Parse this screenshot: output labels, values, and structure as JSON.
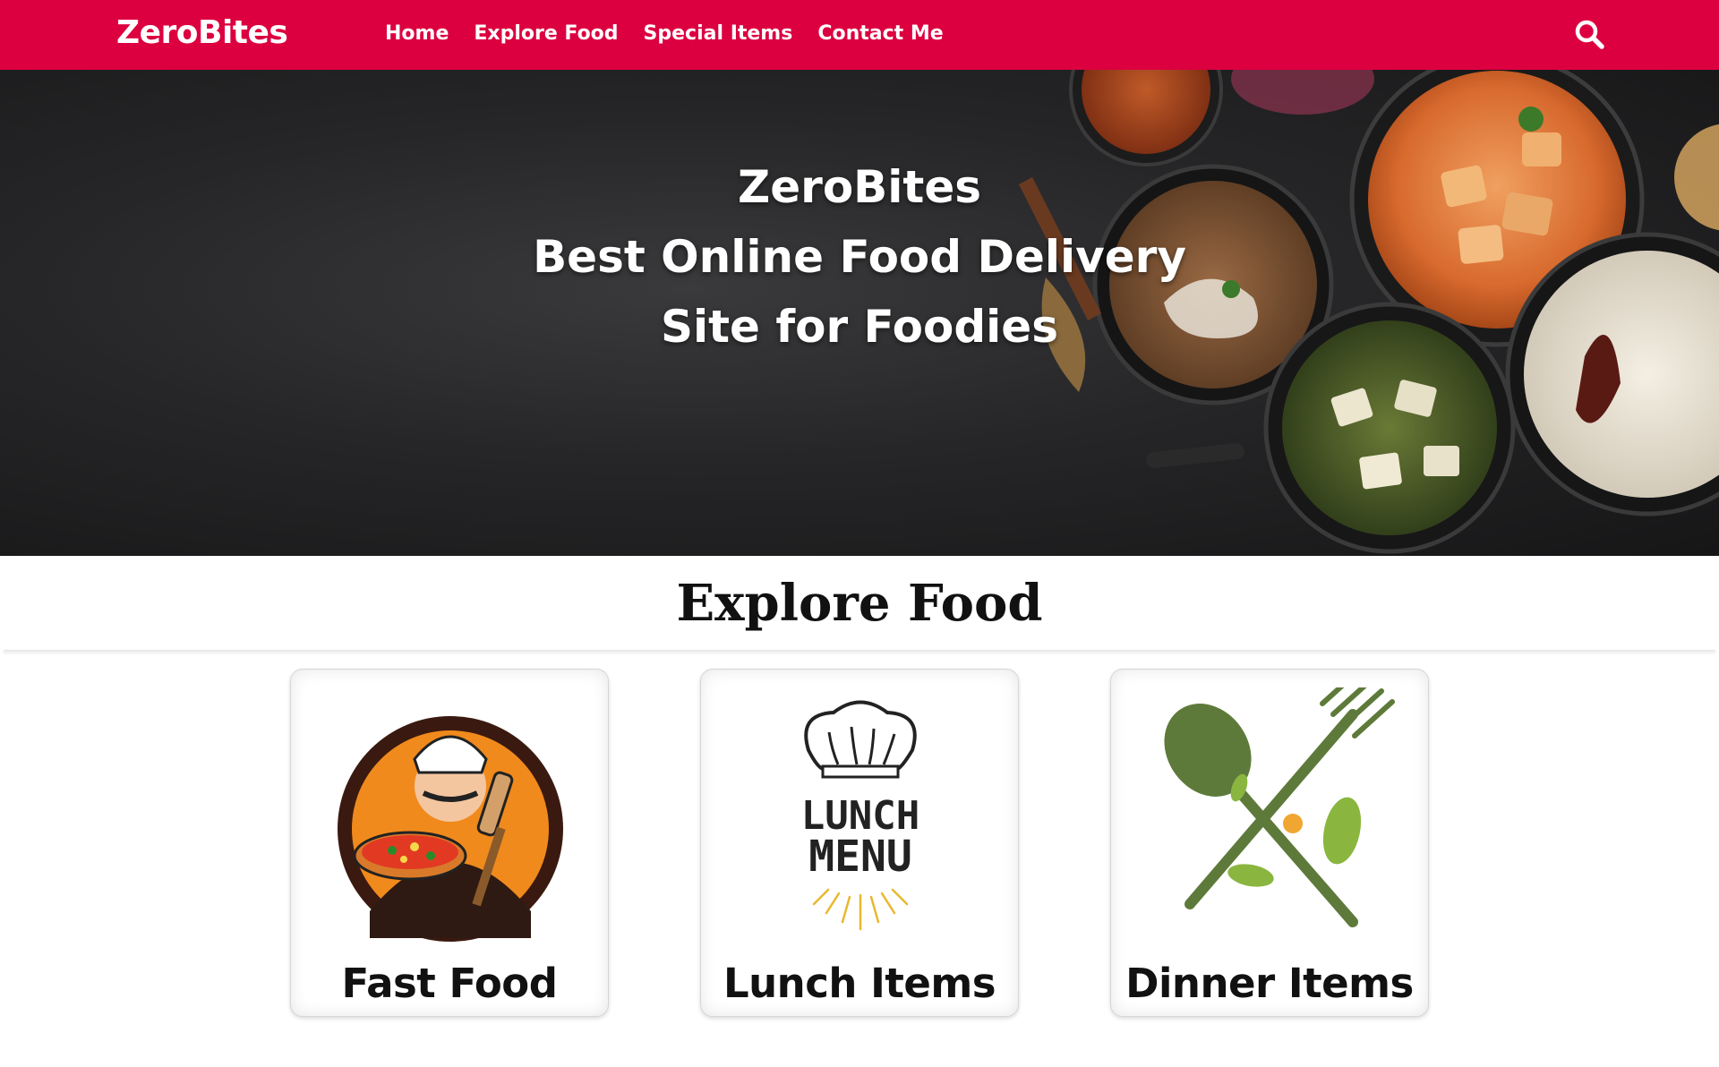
{
  "header": {
    "brand": "ZeroBites",
    "nav": [
      "Home",
      "Explore Food",
      "Special Items",
      "Contact Me"
    ],
    "search_icon": "search-icon",
    "background": "#dc0040"
  },
  "hero": {
    "lines": [
      "ZeroBites",
      "Best Online Food Delivery",
      "Site for Foodies"
    ]
  },
  "explore": {
    "title": "Explore Food",
    "cards": [
      {
        "label": "Fast Food",
        "icon": "chef-with-pizza-icon"
      },
      {
        "label": "Lunch Items",
        "icon": "lunch-menu-chef-hat-icon",
        "image_text": [
          "LUNCH",
          "MENU"
        ]
      },
      {
        "label": "Dinner Items",
        "icon": "spoon-and-fork-icon"
      }
    ]
  }
}
